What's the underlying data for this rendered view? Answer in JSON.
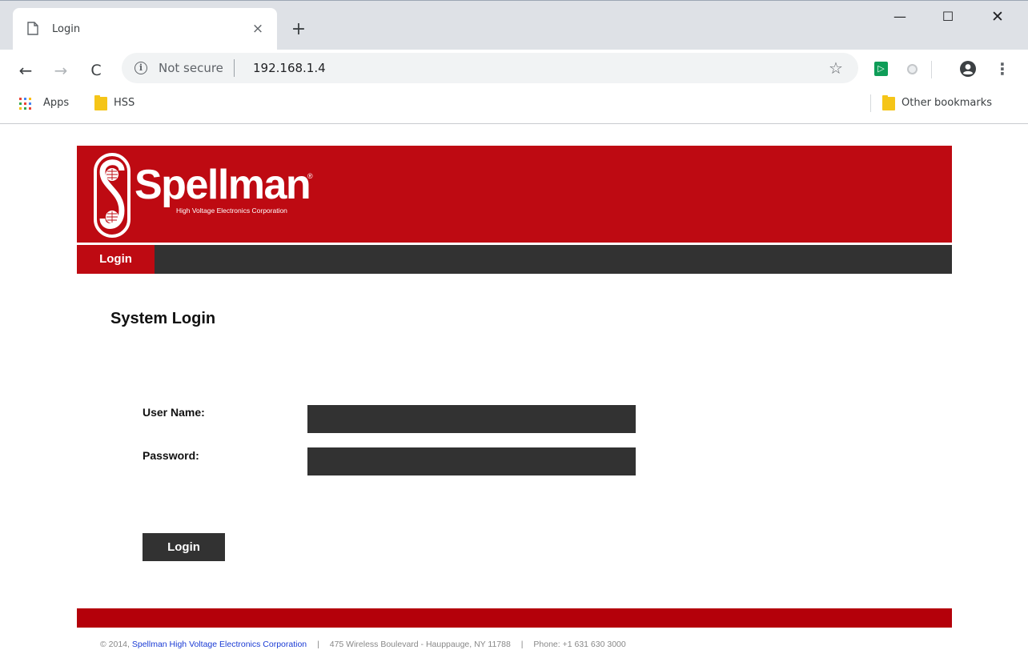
{
  "browser": {
    "tab": {
      "title": "Login",
      "close_glyph": "×"
    },
    "new_tab_glyph": "+",
    "window_controls": {
      "minimize": "—",
      "maximize": "☐",
      "close": "✕"
    },
    "nav": {
      "back": "←",
      "forward": "→",
      "reload": "C"
    },
    "omnibox": {
      "security_label": "Not secure",
      "url": "192.168.1.4",
      "star_icon": "☆"
    },
    "menu_glyph": "⋮",
    "bookmarks": [
      {
        "label": "Apps",
        "icon": "apps-grid-icon"
      },
      {
        "label": "HSS",
        "icon": "folder-icon"
      }
    ],
    "other_bookmarks": {
      "label": "Other bookmarks",
      "icon": "folder-icon"
    }
  },
  "site": {
    "brand": {
      "name": "Spellman",
      "tagline": "High Voltage Electronics Corporation",
      "registered_mark": "®"
    },
    "nav": {
      "active_item": "Login"
    },
    "heading": "System Login",
    "form": {
      "username_label": "User Name:",
      "username_value": "",
      "password_label": "Password:",
      "password_value": "",
      "submit_label": "Login"
    },
    "footer": {
      "copyright_prefix": "© 2014,",
      "company_link": "Spellman High Voltage Electronics Corporation",
      "divider": "|",
      "address": "475 Wireless Boulevard - Hauppauge, NY 11788",
      "phone": "Phone: +1 631 630 3000"
    }
  },
  "colors": {
    "brand_red": "#be0a12",
    "dark_gray": "#323232",
    "footer_red": "#b4000a",
    "link_blue": "#1a3bd4",
    "chrome_gray": "#dee1e6"
  }
}
